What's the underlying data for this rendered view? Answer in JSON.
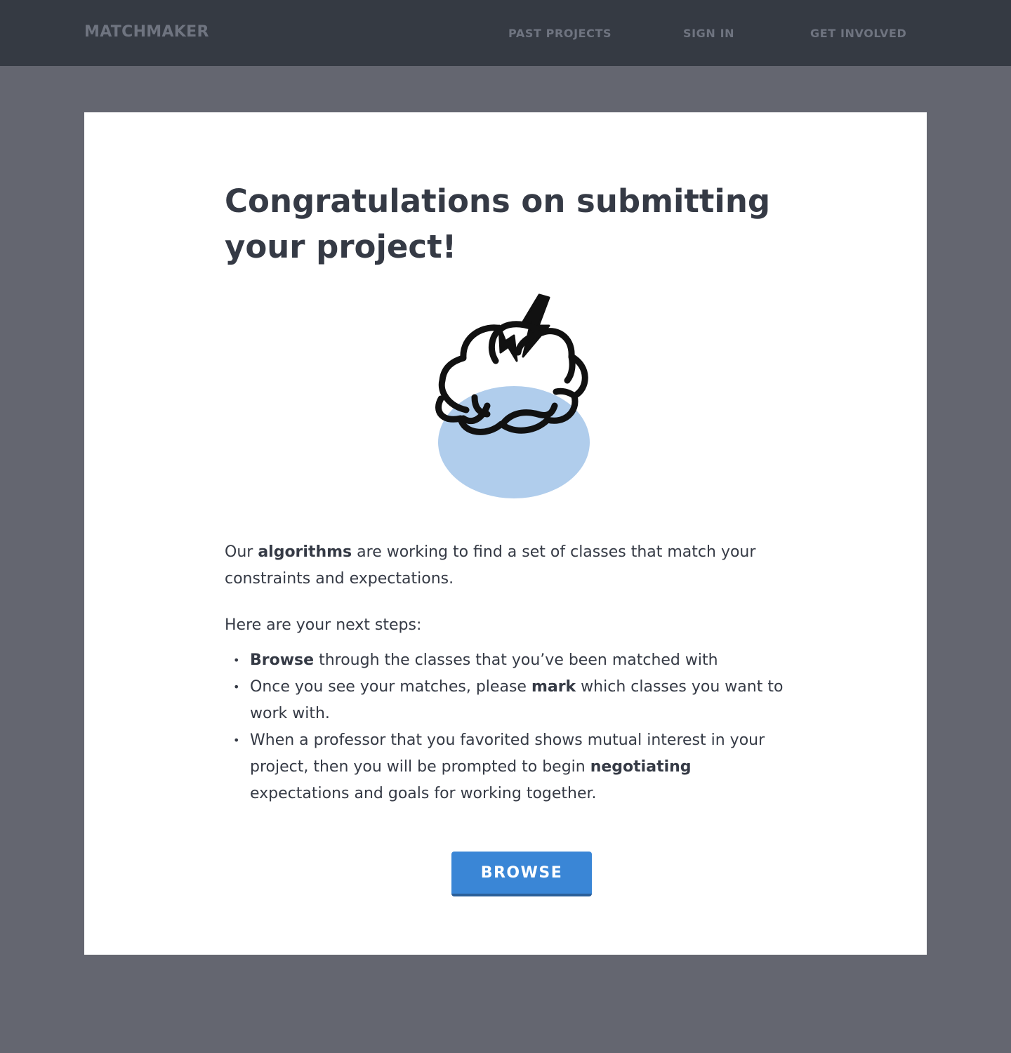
{
  "nav": {
    "brand": "MATCHMAKER",
    "links": [
      {
        "label": "PAST PROJECTS"
      },
      {
        "label": "SIGN IN"
      },
      {
        "label": "GET INVOLVED"
      }
    ]
  },
  "main": {
    "title": "Congratulations on submitting your project!",
    "illustration_icon": "brain-lightning-icon",
    "intro": {
      "before": "Our ",
      "bold": "algorithms",
      "after": " are working to find a set of classes that match your constraints and expectations."
    },
    "steps_label": "Here are your next steps:",
    "steps": [
      {
        "before": "",
        "bold": "Browse",
        "after": " through the classes that you’ve been matched with"
      },
      {
        "before": "Once you see your matches, please ",
        "bold": "mark",
        "after": " which classes you want to work with."
      },
      {
        "before": "When a professor that you favorited shows mutual interest in your project, then you will be prompted to begin ",
        "bold": "negotiating",
        "after": " expectations and goals for working together."
      }
    ],
    "browse_label": "BROWSE"
  },
  "colors": {
    "navbar_bg": "#353a43",
    "page_bg": "#646670",
    "card_bg": "#ffffff",
    "accent": "#3a86d6",
    "text": "#353a45",
    "nav_text": "#6f7480",
    "brain_fill": "#b0cdec"
  }
}
